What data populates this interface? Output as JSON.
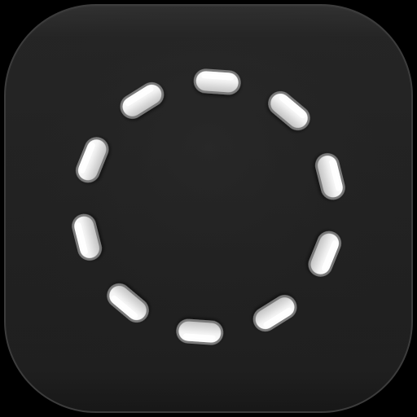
{
  "icon": {
    "semantic": "dashed-circle-icon",
    "background_color": "#000000",
    "tile_color": "#232323",
    "tile_highlight": "#3a3a3a",
    "tile_shadow": "#171717",
    "dash_color": "#f4f4f4",
    "dash_shade": "#bdbdbd",
    "dash_edge": "#7a7a7a",
    "dash_count": 10
  }
}
